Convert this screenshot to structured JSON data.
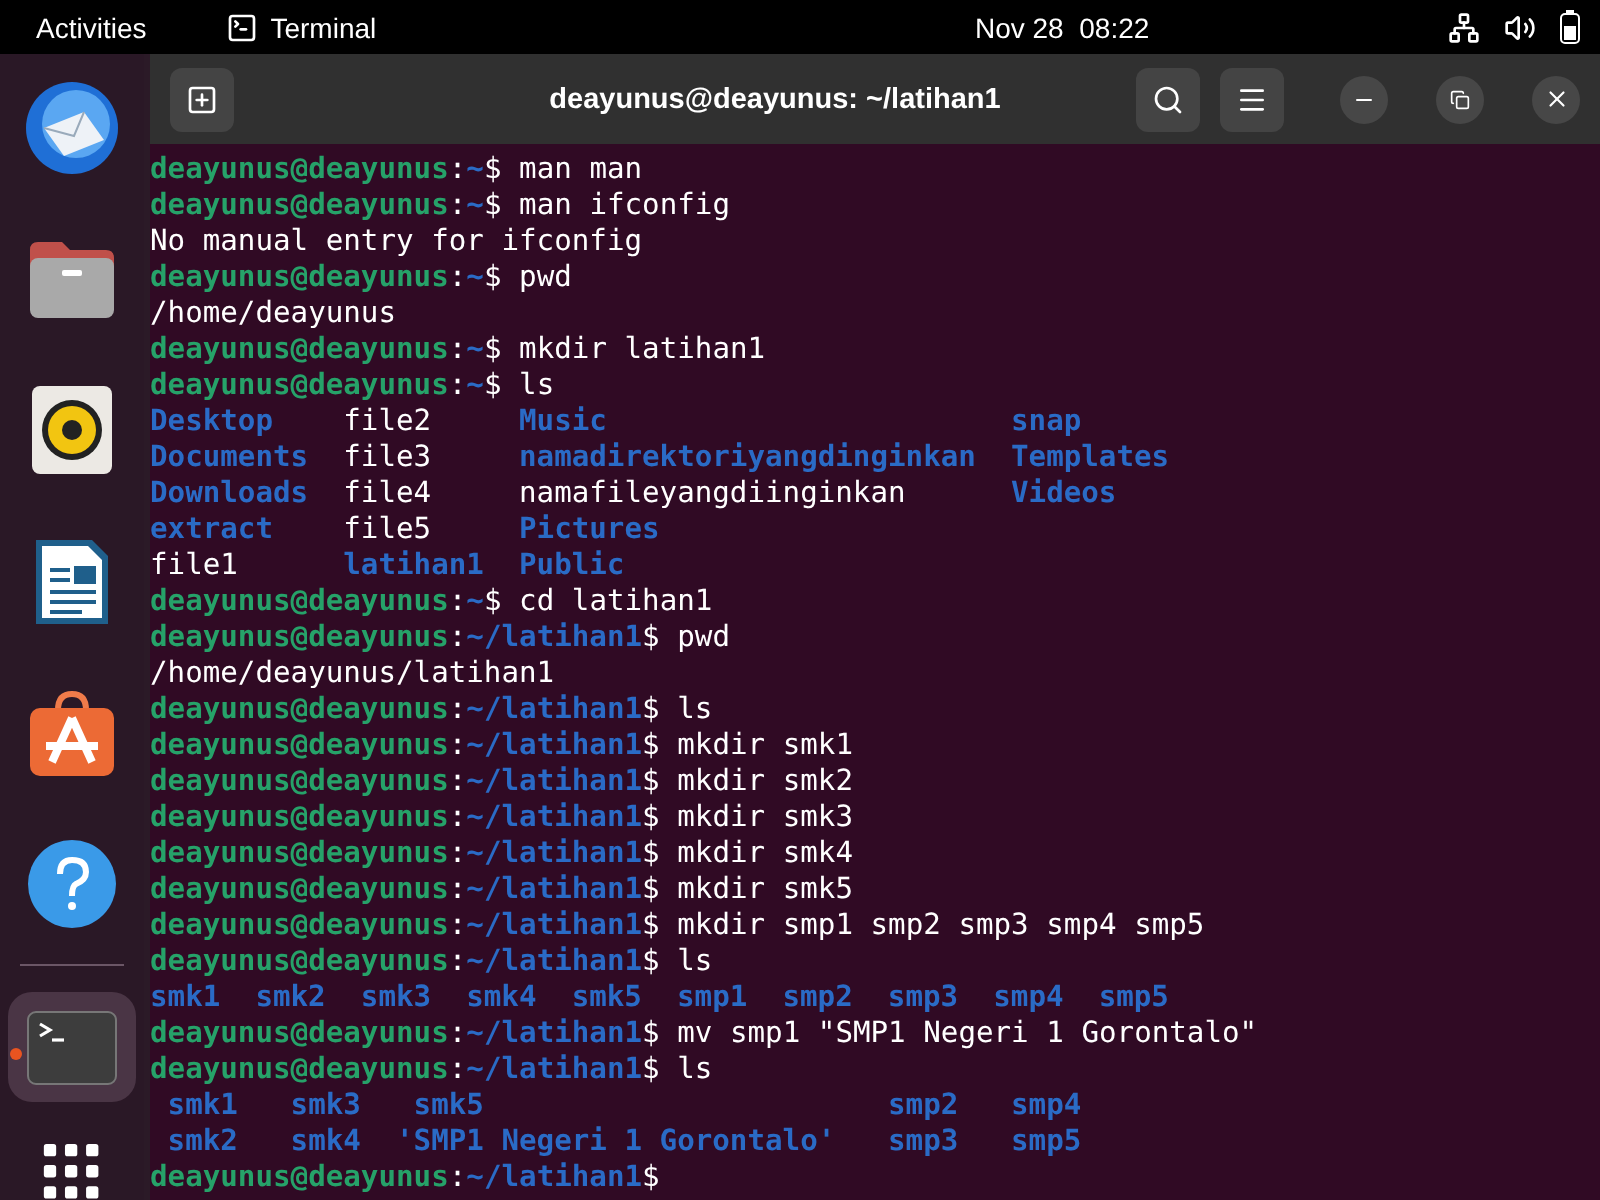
{
  "top_bar": {
    "activities": "Activities",
    "app": "Terminal",
    "clock": "Nov 28  08:22"
  },
  "dock": {
    "apps": [
      {
        "kind": "mail",
        "running": false
      },
      {
        "kind": "files",
        "running": false
      },
      {
        "kind": "music",
        "running": false
      },
      {
        "kind": "writer",
        "running": false
      },
      {
        "kind": "store",
        "running": false
      },
      {
        "kind": "help",
        "running": false
      },
      {
        "kind": "terminal",
        "running": true
      }
    ]
  },
  "window": {
    "title": "deayunus@deayunus: ~/latihan1"
  },
  "terminal": {
    "lines": [
      {
        "kind": "prompt",
        "user": "deayunus@deayunus",
        "sep": ":",
        "path": "~",
        "sign": "$",
        "command": "man man"
      },
      {
        "kind": "prompt",
        "user": "deayunus@deayunus",
        "sep": ":",
        "path": "~",
        "sign": "$",
        "command": "man ifconfig"
      },
      {
        "kind": "output",
        "text": "No manual entry for ifconfig"
      },
      {
        "kind": "prompt",
        "user": "deayunus@deayunus",
        "sep": ":",
        "path": "~",
        "sign": "$",
        "command": "pwd"
      },
      {
        "kind": "output",
        "text": "/home/deayunus"
      },
      {
        "kind": "prompt",
        "user": "deayunus@deayunus",
        "sep": ":",
        "path": "~",
        "sign": "$",
        "command": "mkdir latihan1"
      },
      {
        "kind": "prompt",
        "user": "deayunus@deayunus",
        "sep": ":",
        "path": "~",
        "sign": "$",
        "command": "ls"
      },
      {
        "kind": "ls",
        "quoting": false,
        "rows": [
          [
            {
              "name": "Desktop",
              "kind": "dir"
            },
            {
              "name": "file2",
              "kind": "file"
            },
            {
              "name": "Music",
              "kind": "dir"
            },
            {
              "name": "snap",
              "kind": "dir"
            }
          ],
          [
            {
              "name": "Documents",
              "kind": "dir"
            },
            {
              "name": "file3",
              "kind": "file"
            },
            {
              "name": "namadirektoriyangdinginkan",
              "kind": "dir"
            },
            {
              "name": "Templates",
              "kind": "dir"
            }
          ],
          [
            {
              "name": "Downloads",
              "kind": "dir"
            },
            {
              "name": "file4",
              "kind": "file"
            },
            {
              "name": "namafileyangdiinginkan",
              "kind": "file"
            },
            {
              "name": "Videos",
              "kind": "dir"
            }
          ],
          [
            {
              "name": "extract",
              "kind": "dir"
            },
            {
              "name": "file5",
              "kind": "file"
            },
            {
              "name": "Pictures",
              "kind": "dir"
            }
          ],
          [
            {
              "name": "file1",
              "kind": "file"
            },
            {
              "name": "latihan1",
              "kind": "dir"
            },
            {
              "name": "Public",
              "kind": "dir"
            }
          ]
        ]
      },
      {
        "kind": "prompt",
        "user": "deayunus@deayunus",
        "sep": ":",
        "path": "~",
        "sign": "$",
        "command": "cd latihan1"
      },
      {
        "kind": "prompt",
        "user": "deayunus@deayunus",
        "sep": ":",
        "path": "~/latihan1",
        "sign": "$",
        "command": "pwd"
      },
      {
        "kind": "output",
        "text": "/home/deayunus/latihan1"
      },
      {
        "kind": "prompt",
        "user": "deayunus@deayunus",
        "sep": ":",
        "path": "~/latihan1",
        "sign": "$",
        "command": "ls"
      },
      {
        "kind": "prompt",
        "user": "deayunus@deayunus",
        "sep": ":",
        "path": "~/latihan1",
        "sign": "$",
        "command": "mkdir smk1"
      },
      {
        "kind": "prompt",
        "user": "deayunus@deayunus",
        "sep": ":",
        "path": "~/latihan1",
        "sign": "$",
        "command": "mkdir smk2"
      },
      {
        "kind": "prompt",
        "user": "deayunus@deayunus",
        "sep": ":",
        "path": "~/latihan1",
        "sign": "$",
        "command": "mkdir smk3"
      },
      {
        "kind": "prompt",
        "user": "deayunus@deayunus",
        "sep": ":",
        "path": "~/latihan1",
        "sign": "$",
        "command": "mkdir smk4"
      },
      {
        "kind": "prompt",
        "user": "deayunus@deayunus",
        "sep": ":",
        "path": "~/latihan1",
        "sign": "$",
        "command": "mkdir smk5"
      },
      {
        "kind": "prompt",
        "user": "deayunus@deayunus",
        "sep": ":",
        "path": "~/latihan1",
        "sign": "$",
        "command": "mkdir smp1 smp2 smp3 smp4 smp5"
      },
      {
        "kind": "prompt",
        "user": "deayunus@deayunus",
        "sep": ":",
        "path": "~/latihan1",
        "sign": "$",
        "command": "ls"
      },
      {
        "kind": "ls",
        "quoting": false,
        "rows": [
          [
            {
              "name": "smk1",
              "kind": "dir"
            },
            {
              "name": "smk2",
              "kind": "dir"
            },
            {
              "name": "smk3",
              "kind": "dir"
            },
            {
              "name": "smk4",
              "kind": "dir"
            },
            {
              "name": "smk5",
              "kind": "dir"
            },
            {
              "name": "smp1",
              "kind": "dir"
            },
            {
              "name": "smp2",
              "kind": "dir"
            },
            {
              "name": "smp3",
              "kind": "dir"
            },
            {
              "name": "smp4",
              "kind": "dir"
            },
            {
              "name": "smp5",
              "kind": "dir"
            }
          ]
        ]
      },
      {
        "kind": "prompt",
        "user": "deayunus@deayunus",
        "sep": ":",
        "path": "~/latihan1",
        "sign": "$",
        "command": "mv smp1 \"SMP1 Negeri 1 Gorontalo\""
      },
      {
        "kind": "prompt",
        "user": "deayunus@deayunus",
        "sep": ":",
        "path": "~/latihan1",
        "sign": "$",
        "command": "ls"
      },
      {
        "kind": "ls",
        "quoting": true,
        "rows": [
          [
            {
              "name": "smk1",
              "kind": "dir"
            },
            {
              "name": "smk3",
              "kind": "dir"
            },
            {
              "name": "smk5",
              "kind": "dir"
            },
            {
              "name": "smp2",
              "kind": "dir"
            },
            {
              "name": "smp4",
              "kind": "dir"
            }
          ],
          [
            {
              "name": "smk2",
              "kind": "dir"
            },
            {
              "name": "smk4",
              "kind": "dir"
            },
            {
              "name": "'SMP1 Negeri 1 Gorontalo'",
              "kind": "dir",
              "quoted": true
            },
            {
              "name": "smp3",
              "kind": "dir"
            },
            {
              "name": "smp5",
              "kind": "dir"
            }
          ]
        ]
      },
      {
        "kind": "prompt",
        "user": "deayunus@deayunus",
        "sep": ":",
        "path": "~/latihan1",
        "sign": "$"
      }
    ]
  }
}
